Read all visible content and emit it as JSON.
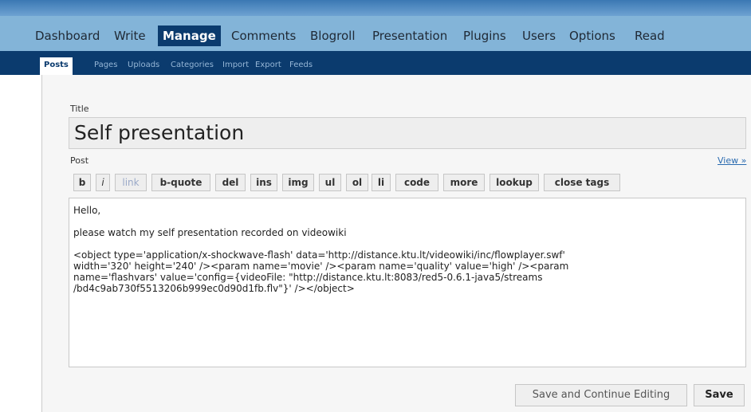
{
  "main_nav": [
    {
      "label": "Dashboard",
      "active": false
    },
    {
      "label": "Write",
      "active": false
    },
    {
      "label": "Manage",
      "active": true
    },
    {
      "label": "Comments",
      "active": false
    },
    {
      "label": "Blogroll",
      "active": false
    },
    {
      "label": "Presentation",
      "active": false
    },
    {
      "label": "Plugins",
      "active": false
    },
    {
      "label": "Users",
      "active": false
    },
    {
      "label": "Options",
      "active": false
    },
    {
      "label": "Read",
      "active": false
    }
  ],
  "sub_nav": [
    {
      "label": "Posts",
      "active": true
    },
    {
      "label": "Pages",
      "active": false
    },
    {
      "label": "Uploads",
      "active": false
    },
    {
      "label": "Categories",
      "active": false
    },
    {
      "label": "Import",
      "active": false
    },
    {
      "label": "Export",
      "active": false
    },
    {
      "label": "Feeds",
      "active": false
    }
  ],
  "form": {
    "title_label": "Title",
    "title_value": "Self presentation",
    "post_label": "Post",
    "view_link": "View »"
  },
  "quicktags": [
    "b",
    "i",
    "link",
    "b-quote",
    "del",
    "ins",
    "img",
    "ul",
    "ol",
    "li",
    "code",
    "more",
    "lookup",
    "close tags"
  ],
  "editor": {
    "paragraphs": [
      "Hello,",
      "please watch my self presentation recorded on videowiki",
      "<object type='application/x-shockwave-flash' data='http://distance.ktu.lt/videowiki/inc/flowplayer.swf'\nwidth='320' height='240' /><param name='movie' /><param name='quality' value='high' /><param\nname='flashvars' value='config={videoFile: \"http://distance.ktu.lt:8083/red5-0.6.1-java5/streams\n/bd4c9ab730f5513206b999ec0d90d1fb.flv\"}' /></object>"
    ]
  },
  "buttons": {
    "save_continue": "Save and Continue Editing",
    "save": "Save"
  },
  "colors": {
    "main_nav_bg": "#83b4d8",
    "active_tab_bg": "#0b3b6e",
    "top_bar": "#3b78b3"
  }
}
